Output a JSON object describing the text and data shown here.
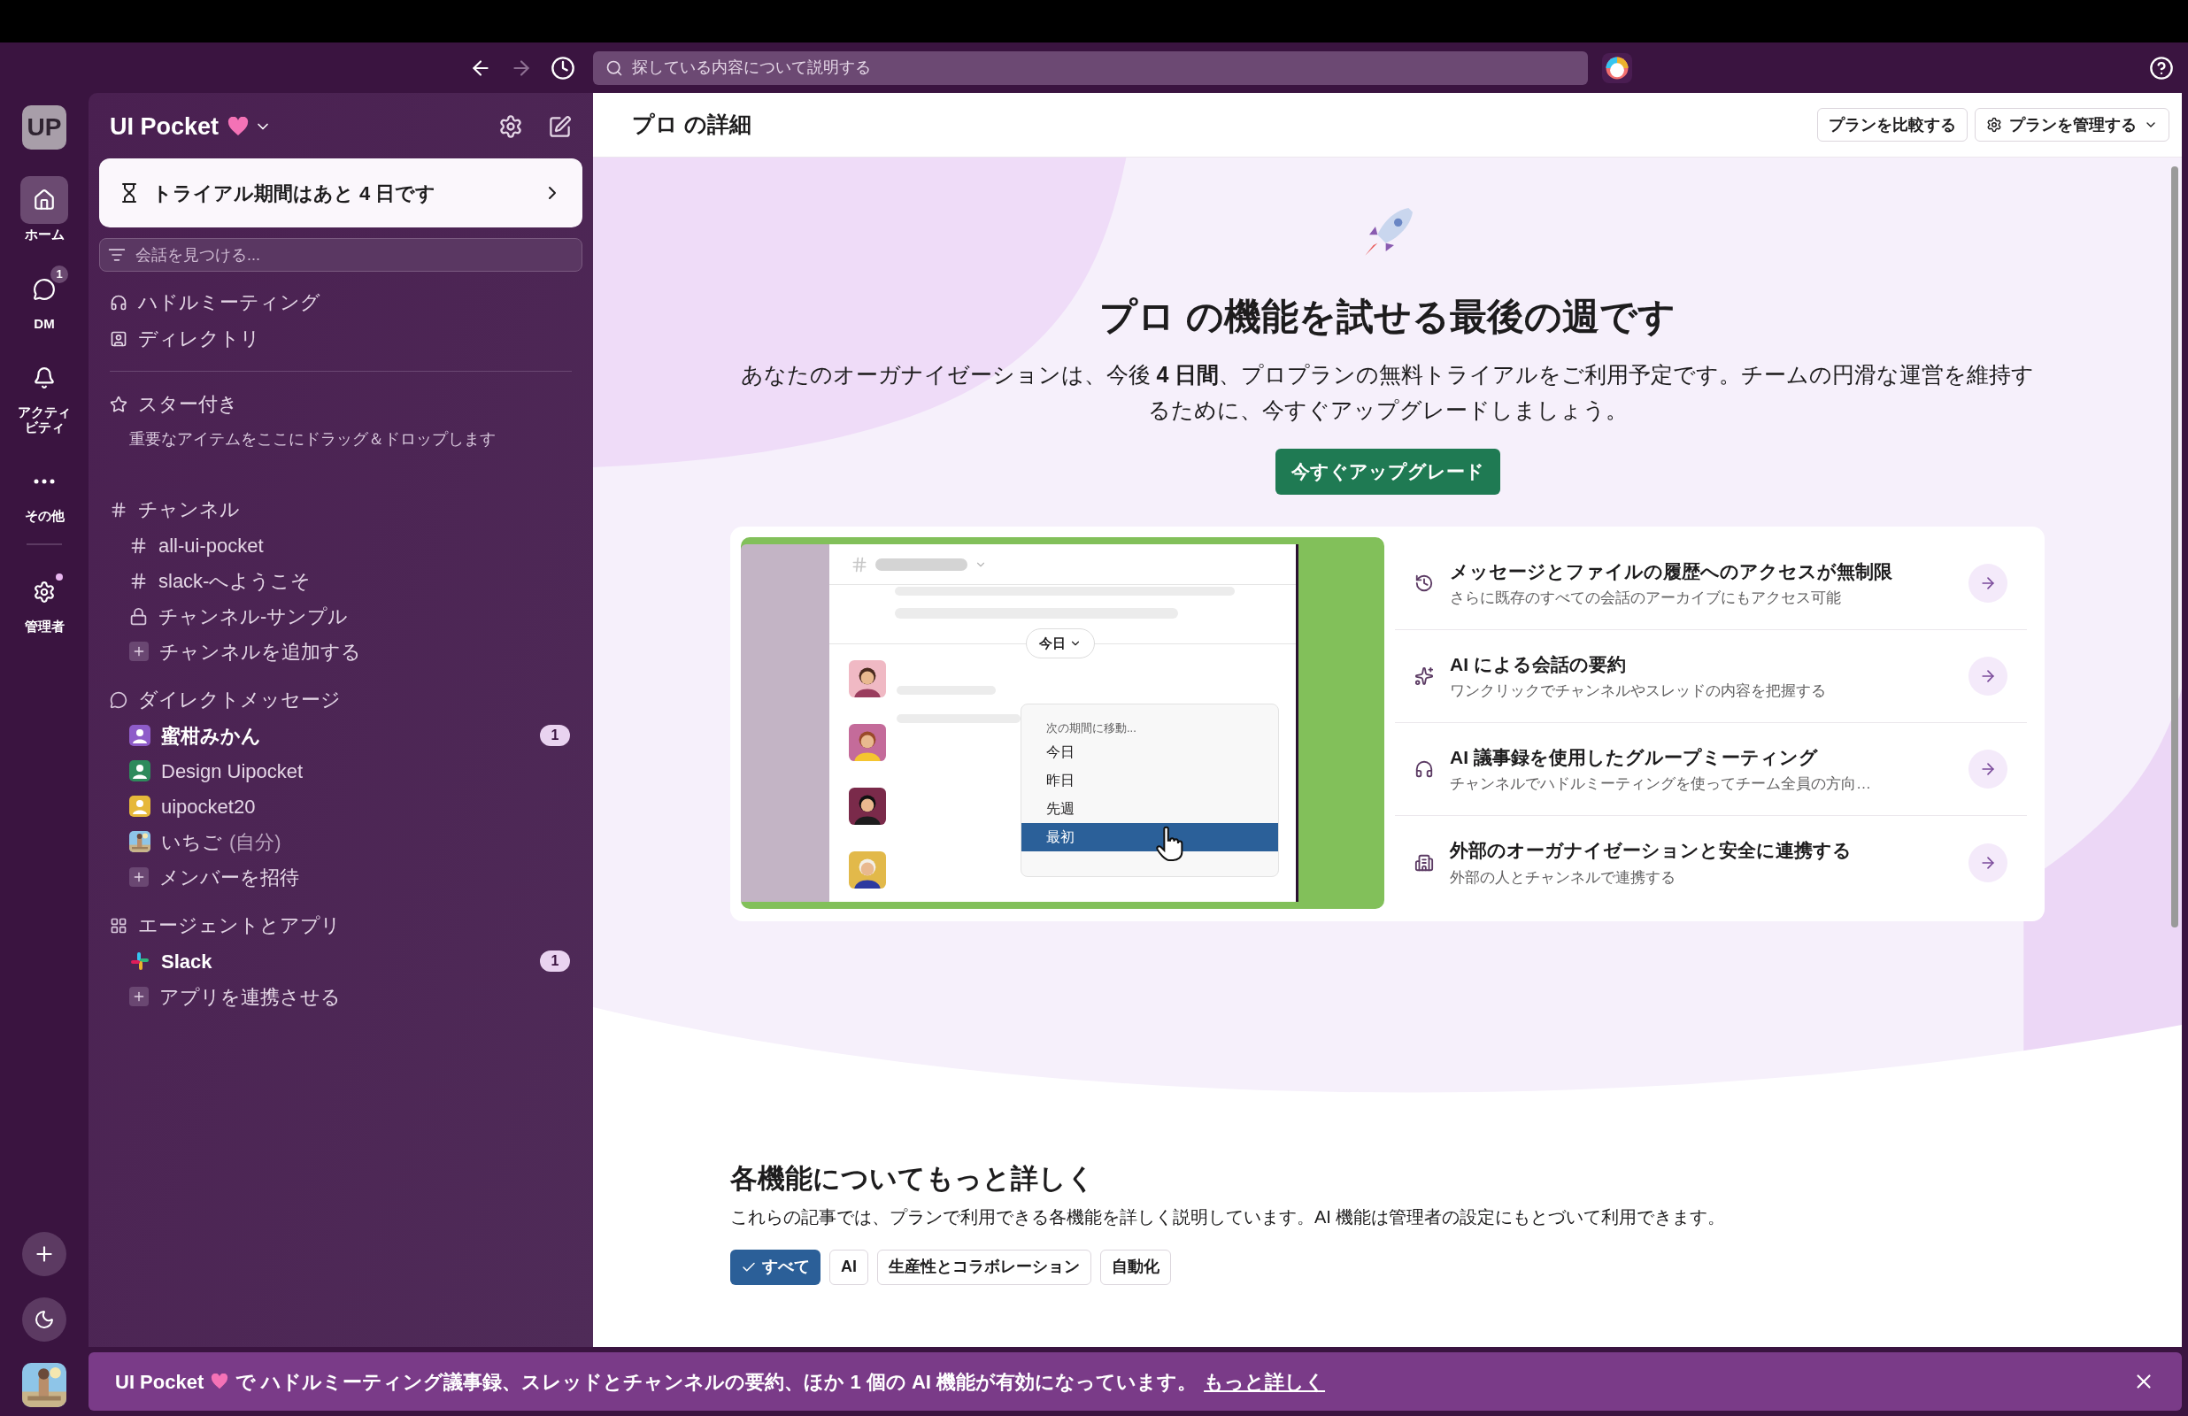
{
  "top_bar": {
    "search": {
      "placeholder": "探している内容について説明する"
    }
  },
  "rail": {
    "workspace": "UP",
    "items": [
      {
        "kind": "home",
        "label": "ホーム",
        "selected": true,
        "dot": false
      },
      {
        "kind": "dm",
        "label": "DM",
        "selected": false,
        "badge": "1",
        "dot": false
      },
      {
        "kind": "activity",
        "label": "アクティビティ",
        "selected": false,
        "dot": false
      },
      {
        "kind": "more",
        "label": "その他",
        "selected": false,
        "dot": false
      },
      {
        "kind": "admin",
        "label": "管理者",
        "selected": false,
        "dot": true
      }
    ]
  },
  "sidebar": {
    "workspace_name": "UI Pocket",
    "trial": "トライアル期間はあと 4 日です",
    "find": {
      "placeholder": "会話を見つける..."
    },
    "nav": [
      {
        "kind": "huddle",
        "label": "ハドルミーティング"
      },
      {
        "kind": "directory",
        "label": "ディレクトリ"
      }
    ],
    "starred": {
      "title": "スター付き",
      "hint": "重要なアイテムをここにドラッグ＆ドロップします"
    },
    "sections": [
      {
        "kind": "channels",
        "title": "チャンネル",
        "items": [
          {
            "kind": "public",
            "name": "all-ui-pocket",
            "unread": false
          },
          {
            "kind": "public",
            "name": "slack-へようこそ",
            "unread": false
          },
          {
            "kind": "private",
            "name": "チャンネル-サンプル",
            "unread": false
          },
          {
            "kind": "add",
            "name": "チャンネルを追加する",
            "unread": false
          }
        ]
      },
      {
        "kind": "dms",
        "title": "ダイレクトメッセージ",
        "items": [
          {
            "kind": "user",
            "name": "蜜柑みかん",
            "unread": true,
            "badge": "1",
            "color": "#8e5cc9"
          },
          {
            "kind": "user",
            "name": "Design Uipocket",
            "unread": false,
            "color": "#2e8a5c"
          },
          {
            "kind": "user",
            "name": "uipocket20",
            "unread": false,
            "color": "#e6b83a"
          },
          {
            "kind": "self",
            "name": "いちご",
            "suffix": "(自分)",
            "unread": false
          },
          {
            "kind": "add",
            "name": "メンバーを招待",
            "unread": false
          }
        ]
      },
      {
        "kind": "apps",
        "title": "エージェントとアプリ",
        "items": [
          {
            "kind": "app",
            "name": "Slack",
            "unread": true,
            "badge": "1"
          },
          {
            "kind": "add",
            "name": "アプリを連携させる",
            "unread": false
          }
        ]
      }
    ]
  },
  "main": {
    "title": "プロ の詳細",
    "buttons": [
      {
        "kind": "compare",
        "label": "プランを比較する"
      },
      {
        "kind": "manage",
        "label": "プランを管理する"
      }
    ],
    "hero": {
      "title": "プロ の機能を試せる最後の週です",
      "text": "あなたのオーガナイゼーションは、今後 **4 日間**、プロプランの無料トライアルをご利用予定です。チームの円滑な運営を維持するために、今すぐアップグレードしましょう。",
      "button": "今すぐアップグレード"
    },
    "illustration": {
      "date_chip": "今日",
      "menu_title": "次の期間に移動...",
      "options": [
        {
          "label": "今日",
          "selected": false
        },
        {
          "label": "昨日",
          "selected": false
        },
        {
          "label": "先週",
          "selected": false
        },
        {
          "label": "最初",
          "selected": true
        }
      ]
    },
    "features": [
      {
        "kind": "history",
        "title": "メッセージとファイルの履歴へのアクセスが無制限",
        "text": "さらに既存のすべての会話のアーカイブにもアクセス可能"
      },
      {
        "kind": "summary",
        "title": "AI による会話の要約",
        "text": "ワンクリックでチャンネルやスレッドの内容を把握する"
      },
      {
        "kind": "huddle",
        "title": "AI 議事録を使用したグループミーティング",
        "text": "チャンネルでハドルミーティングを使ってチーム全員の方向…"
      },
      {
        "kind": "external",
        "title": "外部のオーガナイゼーションと安全に連携する",
        "text": "外部の人とチャンネルで連携する"
      }
    ],
    "learn": {
      "title": "各機能についてもっと詳しく",
      "text": "これらの記事では、プランで利用できる各機能を詳しく説明しています。AI 機能は管理者の設定にもとづいて利用できます。",
      "filters": [
        {
          "label": "すべて",
          "selected": true
        },
        {
          "label": "AI",
          "selected": false
        },
        {
          "label": "生産性とコラボレーション",
          "selected": false
        },
        {
          "label": "自動化",
          "selected": false
        }
      ]
    }
  },
  "banner": {
    "workspace": "UI Pocket",
    "text": "で ハドルミーティング議事録、スレッドとチャンネルの要約、ほか 1 個の AI 機能が有効になっています。",
    "link": "もっと詳しく"
  }
}
